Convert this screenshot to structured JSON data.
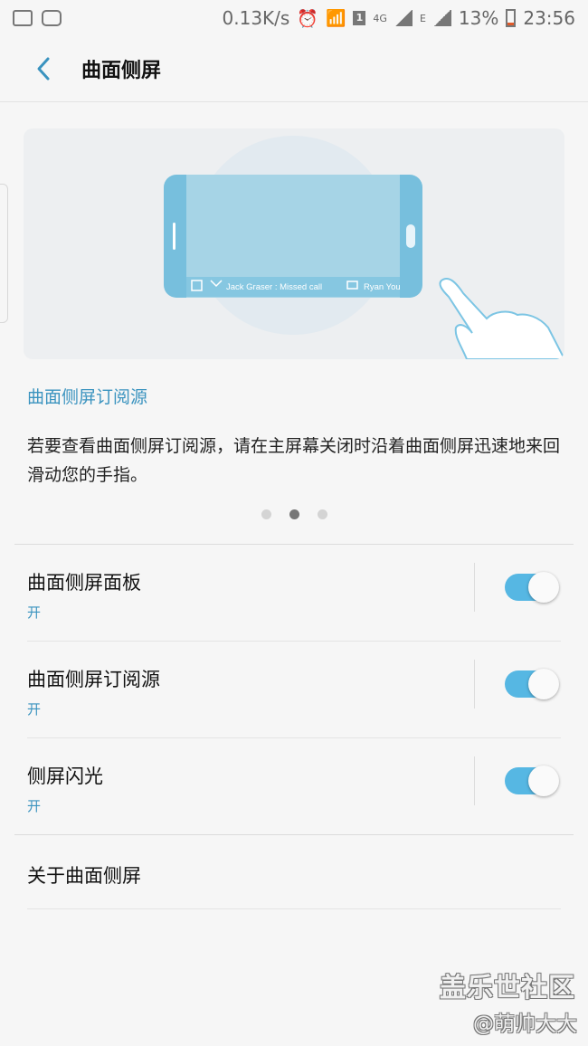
{
  "status_bar": {
    "net_speed": "0.13K/s",
    "sim_label": "1",
    "network_4g": "4G",
    "network_e": "E",
    "battery": "13%",
    "time": "23:56"
  },
  "header": {
    "title": "曲面侧屏"
  },
  "illustration": {
    "notif_missed": "Jack Graser : Missed call",
    "notif_message": "Ryan You"
  },
  "feed": {
    "link_label": "曲面侧屏订阅源",
    "description": "若要查看曲面侧屏订阅源，请在主屏幕关闭时沿着曲面侧屏迅速地来回滑动您的手指。"
  },
  "pager": {
    "count": 3,
    "active_index": 1
  },
  "settings": [
    {
      "title": "曲面侧屏面板",
      "status": "开",
      "enabled": true
    },
    {
      "title": "曲面侧屏订阅源",
      "status": "开",
      "enabled": true
    },
    {
      "title": "侧屏闪光",
      "status": "开",
      "enabled": true
    }
  ],
  "about": {
    "label": "关于曲面侧屏"
  },
  "watermark": {
    "logo": "盖乐世社区",
    "user": "@萌帅大大"
  },
  "colors": {
    "accent": "#3a93bf",
    "toggle_on": "#56b7e3",
    "background": "#f6f6f6"
  }
}
